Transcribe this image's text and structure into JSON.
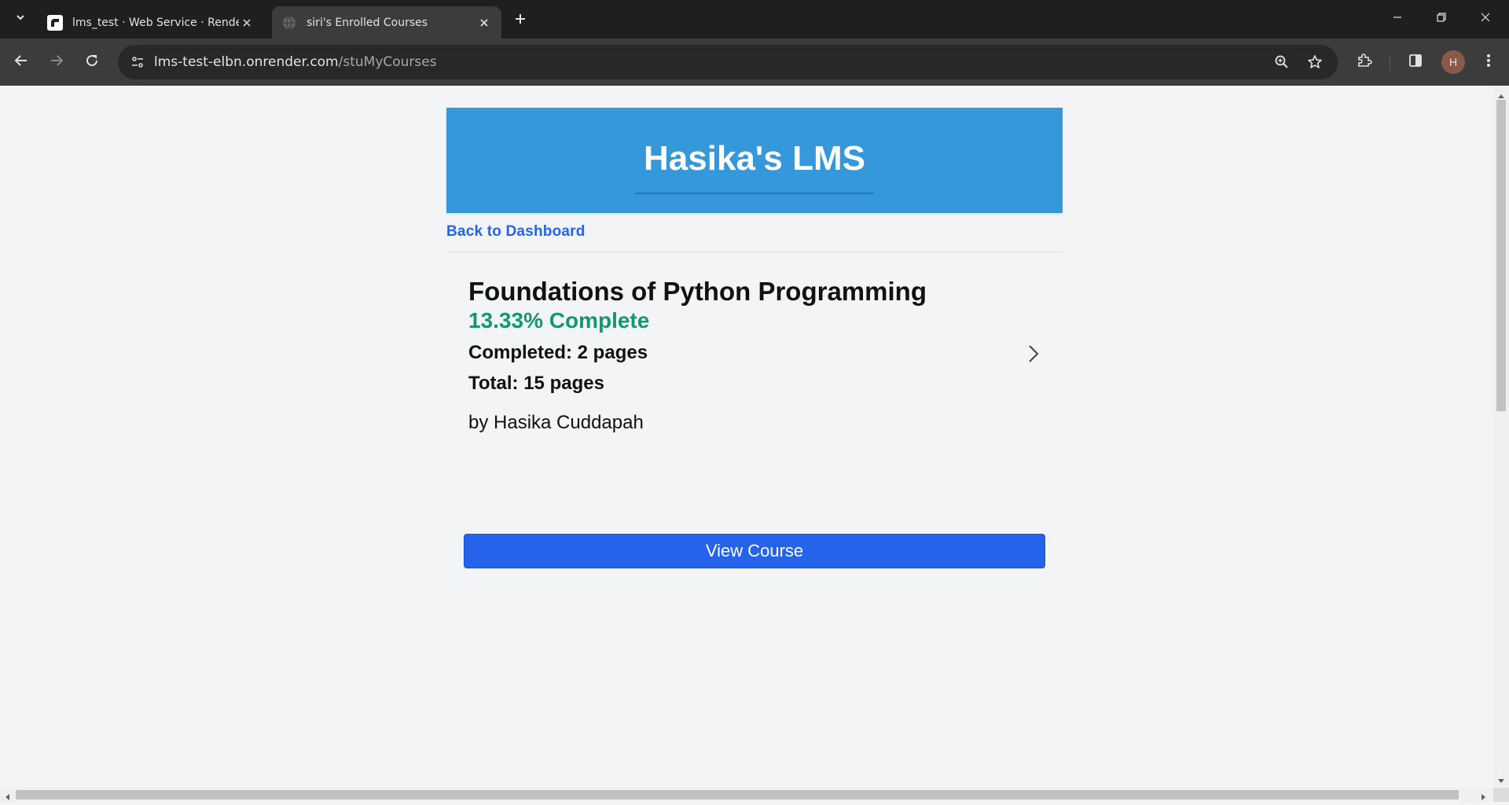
{
  "browser": {
    "tabs": [
      {
        "title": "lms_test · Web Service · Render",
        "favicon": "render-logo-icon",
        "active": false
      },
      {
        "title": "siri's Enrolled Courses",
        "favicon": "globe-icon",
        "active": true
      }
    ],
    "address_bar": {
      "domain": "lms-test-elbn.onrender.com",
      "path": "/stuMyCourses"
    },
    "profile_initial": "H"
  },
  "page": {
    "header": {
      "title": "Hasika's LMS",
      "color": "#3498db"
    },
    "back_link": "Back to Dashboard",
    "courses": [
      {
        "title": "Foundations of Python Programming",
        "progress": "13.33% Complete",
        "progress_percent": 13.33,
        "completed": "Completed: 2 pages",
        "total": "Total: 15 pages",
        "author": "by Hasika Cuddapah",
        "button_label": "View Course"
      }
    ],
    "colors": {
      "accent": "#2563eb",
      "progress": "#16976b"
    }
  }
}
